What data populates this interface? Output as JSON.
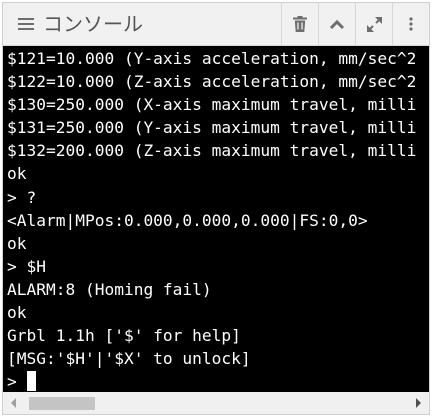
{
  "header": {
    "title": "コンソール",
    "icons": [
      "menu-icon",
      "trash-icon",
      "chevron-up-icon",
      "expand-icon",
      "more-vertical-icon"
    ]
  },
  "terminal": {
    "lines": [
      "$121=10.000 (Y-axis acceleration, mm/sec^2",
      "$122=10.000 (Z-axis acceleration, mm/sec^2",
      "$130=250.000 (X-axis maximum travel, milli",
      "$131=250.000 (Y-axis maximum travel, milli",
      "$132=200.000 (Z-axis maximum travel, milli",
      "ok",
      "> ?",
      "<Alarm|MPos:0.000,0.000,0.000|FS:0,0>",
      "ok",
      "> $H",
      "ALARM:8 (Homing fail)",
      "ok",
      "Grbl 1.1h ['$' for help]",
      "[MSG:'$H'|'$X' to unlock]"
    ],
    "prompt": ">"
  },
  "scrollbar": {
    "left_icon": "arrow-left-icon",
    "right_icon": "arrow-right-icon"
  }
}
